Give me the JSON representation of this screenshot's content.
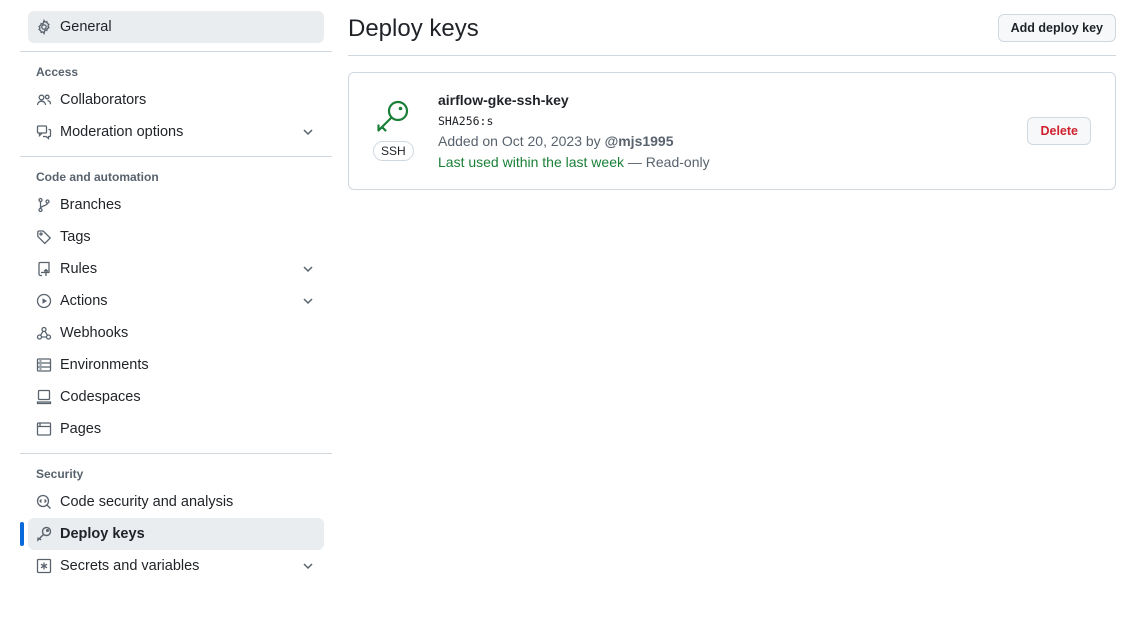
{
  "sidebar": {
    "top_item": {
      "label": "General",
      "icon": "gear-icon"
    },
    "groups": [
      {
        "label": "Access",
        "items": [
          {
            "label": "Collaborators",
            "icon": "people-icon"
          },
          {
            "label": "Moderation options",
            "icon": "comment-discussion-icon",
            "expandable": true
          }
        ]
      },
      {
        "label": "Code and automation",
        "items": [
          {
            "label": "Branches",
            "icon": "git-branch-icon"
          },
          {
            "label": "Tags",
            "icon": "tag-icon"
          },
          {
            "label": "Rules",
            "icon": "repo-push-icon",
            "expandable": true
          },
          {
            "label": "Actions",
            "icon": "play-icon",
            "expandable": true
          },
          {
            "label": "Webhooks",
            "icon": "webhook-icon"
          },
          {
            "label": "Environments",
            "icon": "server-icon"
          },
          {
            "label": "Codespaces",
            "icon": "codespaces-icon"
          },
          {
            "label": "Pages",
            "icon": "browser-icon"
          }
        ]
      },
      {
        "label": "Security",
        "items": [
          {
            "label": "Code security and analysis",
            "icon": "codescan-icon"
          },
          {
            "label": "Deploy keys",
            "icon": "key-icon",
            "current": true
          },
          {
            "label": "Secrets and variables",
            "icon": "key-asterisk-icon",
            "expandable": true
          }
        ]
      }
    ]
  },
  "main": {
    "title": "Deploy keys",
    "add_button": "Add deploy key",
    "key": {
      "name": "airflow-gke-ssh-key",
      "badge": "SSH",
      "fingerprint": "SHA256:s",
      "added_prefix": "Added on Oct 20, 2023 by",
      "added_by": "@mjs1995",
      "last_used": "Last used within the last week",
      "access": " — Read-only",
      "delete_button": "Delete"
    }
  },
  "colors": {
    "accent": "#0969da",
    "success": "#1a7f37",
    "danger": "#cf222e"
  }
}
